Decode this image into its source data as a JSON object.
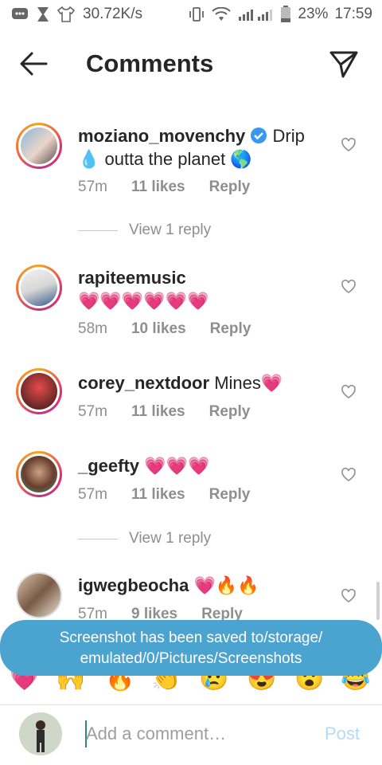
{
  "status": {
    "speed": "30.72K/s",
    "battery": "23%",
    "time": "17:59",
    "icons": [
      "message-icon",
      "hourglass-icon",
      "tshirt-icon",
      "vibrate-icon",
      "wifi-icon",
      "signal-icon",
      "battery-icon"
    ]
  },
  "header": {
    "title": "Comments"
  },
  "comments": [
    {
      "username": "moziano_movenchy",
      "text": "Drip 💧 outta the planet 🌎",
      "time": "57m",
      "likes": "11 likes",
      "reply": "Reply",
      "verified": true
    },
    {
      "username": "rapiteemusic",
      "text": "💗💗💗💗💗💗",
      "time": "58m",
      "likes": "10 likes",
      "reply": "Reply"
    },
    {
      "username": "corey_nextdoor",
      "text": "Mines💗",
      "time": "57m",
      "likes": "11 likes",
      "reply": "Reply"
    },
    {
      "username": "_geefty",
      "text": "💗💗💗",
      "time": "57m",
      "likes": "11 likes",
      "reply": "Reply"
    },
    {
      "username": "igwegbeocha",
      "text": "💗🔥🔥",
      "time": "57m",
      "likes": "9 likes",
      "reply": "Reply"
    }
  ],
  "view_replies": [
    "View 1 reply",
    "View 1 reply"
  ],
  "toast": {
    "line1": "Screenshot has been saved to/storage/",
    "line2": "emulated/0/Pictures/Screenshots"
  },
  "emojis": [
    "💗",
    "🙌",
    "🔥",
    "👏",
    "😢",
    "😍",
    "😮",
    "😂"
  ],
  "composer": {
    "placeholder": "Add a comment…",
    "post": "Post"
  },
  "colors": {
    "accent": "#3897f0",
    "ring": "#e1306c",
    "toast": "#4ba3cf"
  }
}
